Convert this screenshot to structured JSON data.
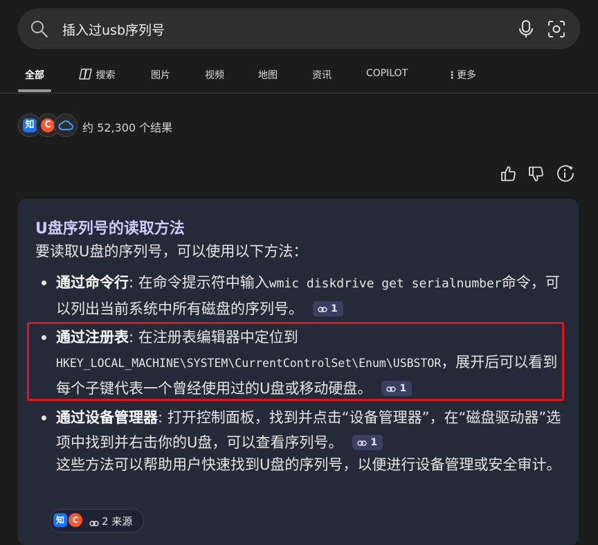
{
  "search": {
    "query": "插入过usb序列号"
  },
  "tabs": [
    {
      "label": "全部"
    },
    {
      "label": "搜索"
    },
    {
      "label": "图片"
    },
    {
      "label": "视频"
    },
    {
      "label": "地图"
    },
    {
      "label": "资讯"
    },
    {
      "label": "COPILOT"
    },
    {
      "label": "更多"
    }
  ],
  "results": {
    "source_icons": [
      "知",
      "C",
      "cloud-icon"
    ],
    "count_text": "约 52,300 个结果"
  },
  "answer": {
    "title": "U盘序列号的读取方法",
    "intro": "要读取U盘的序列号，可以使用以下方法：",
    "bullets": [
      {
        "bold": "通过命令行",
        "text1": ": 在命令提示符中输入",
        "code": "wmic diskdrive get serialnumber",
        "text2": "命令，可以列出当前系统中所有磁盘的序列号。",
        "cite": "1"
      },
      {
        "bold": "通过注册表",
        "text1": ": 在注册表编辑器中定位到",
        "code": "HKEY_LOCAL_MACHINE\\SYSTEM\\CurrentControlSet\\Enum\\USBSTOR",
        "text2": "，展开后可以看到每个子键代表一个曾经使用过的U盘或移动硬盘。",
        "cite": "1"
      },
      {
        "bold": "通过设备管理器",
        "text1": ": 打开控制面板，找到并点击“设备管理器”，在“磁盘驱动器”选项中找到并右击你的U盘，可以查看序列号。",
        "cite": "1"
      }
    ],
    "summary": "这些方法可以帮助用户快速找到U盘的序列号，以便进行设备管理或安全审计。",
    "sources_label": "2 来源",
    "sources_icons": [
      "知",
      "C"
    ]
  },
  "colors": {
    "zhihu": "#1772f6",
    "csdn": "#fc5531",
    "highlight": "#e0141e"
  }
}
